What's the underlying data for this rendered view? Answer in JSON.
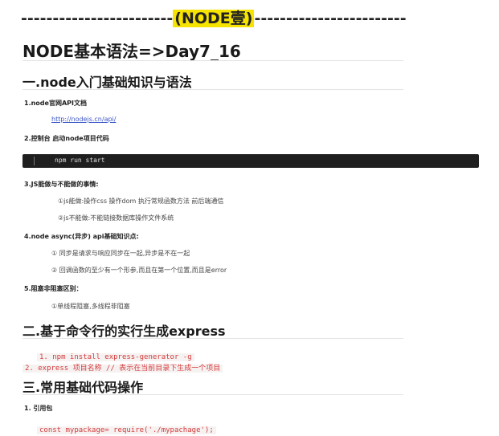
{
  "separator": {
    "left": "------------------------",
    "title": "(NODE壹)",
    "right": "------------------------"
  },
  "page_title": "NODE基本语法=>Day7_16",
  "sections": [
    {
      "heading": "一.node入门基础知识与语法",
      "items": [
        {
          "label": "1.node官网API文档",
          "link": "http://nodejs.cn/api/"
        },
        {
          "label": "2.控制台 启动node项目代码",
          "code": "npm run start"
        },
        {
          "label": "3.JS能做与不能做的事情:",
          "subitems": [
            "①js能做:操作css 操作dom 执行常规函数方法 前后端通信",
            "②js不能做:不能链接数据库操作文件系统"
          ]
        },
        {
          "label": "4.node async(异步) api基础知识点:",
          "subitems": [
            "① 同步是请求与响应同步在一起,异步是不在一起",
            "② 回调函数的至少有一个形参,而且在第一个位置,而且是error"
          ]
        },
        {
          "label": "5.阻塞非阻塞区别：",
          "subitems": [
            "①单线程阻塞,多线程非阻塞"
          ]
        }
      ]
    },
    {
      "heading": "二.基于命令行的实行生成express",
      "code_lines": [
        "1. npm install express-generator -g",
        "2. express 项目名称 // 表示在当前目录下生成一个项目"
      ]
    },
    {
      "heading": "三.常用基础代码操作",
      "items": [
        {
          "label": "1. 引用包",
          "code": "const mypackage= require('./mypachage');"
        }
      ]
    }
  ]
}
